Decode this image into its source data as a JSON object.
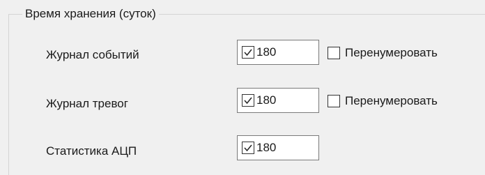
{
  "group": {
    "title": "Время хранения (суток)"
  },
  "rows": [
    {
      "label": "Журнал событий",
      "value": "180",
      "checked": true,
      "renumber_label": "Перенумеровать",
      "renumber_checked": false
    },
    {
      "label": "Журнал тревог",
      "value": "180",
      "checked": true,
      "renumber_label": "Перенумеровать",
      "renumber_checked": false
    },
    {
      "label": "Статистика АЦП",
      "value": "180",
      "checked": true
    }
  ],
  "icons": {
    "check": "checkmark-icon"
  }
}
